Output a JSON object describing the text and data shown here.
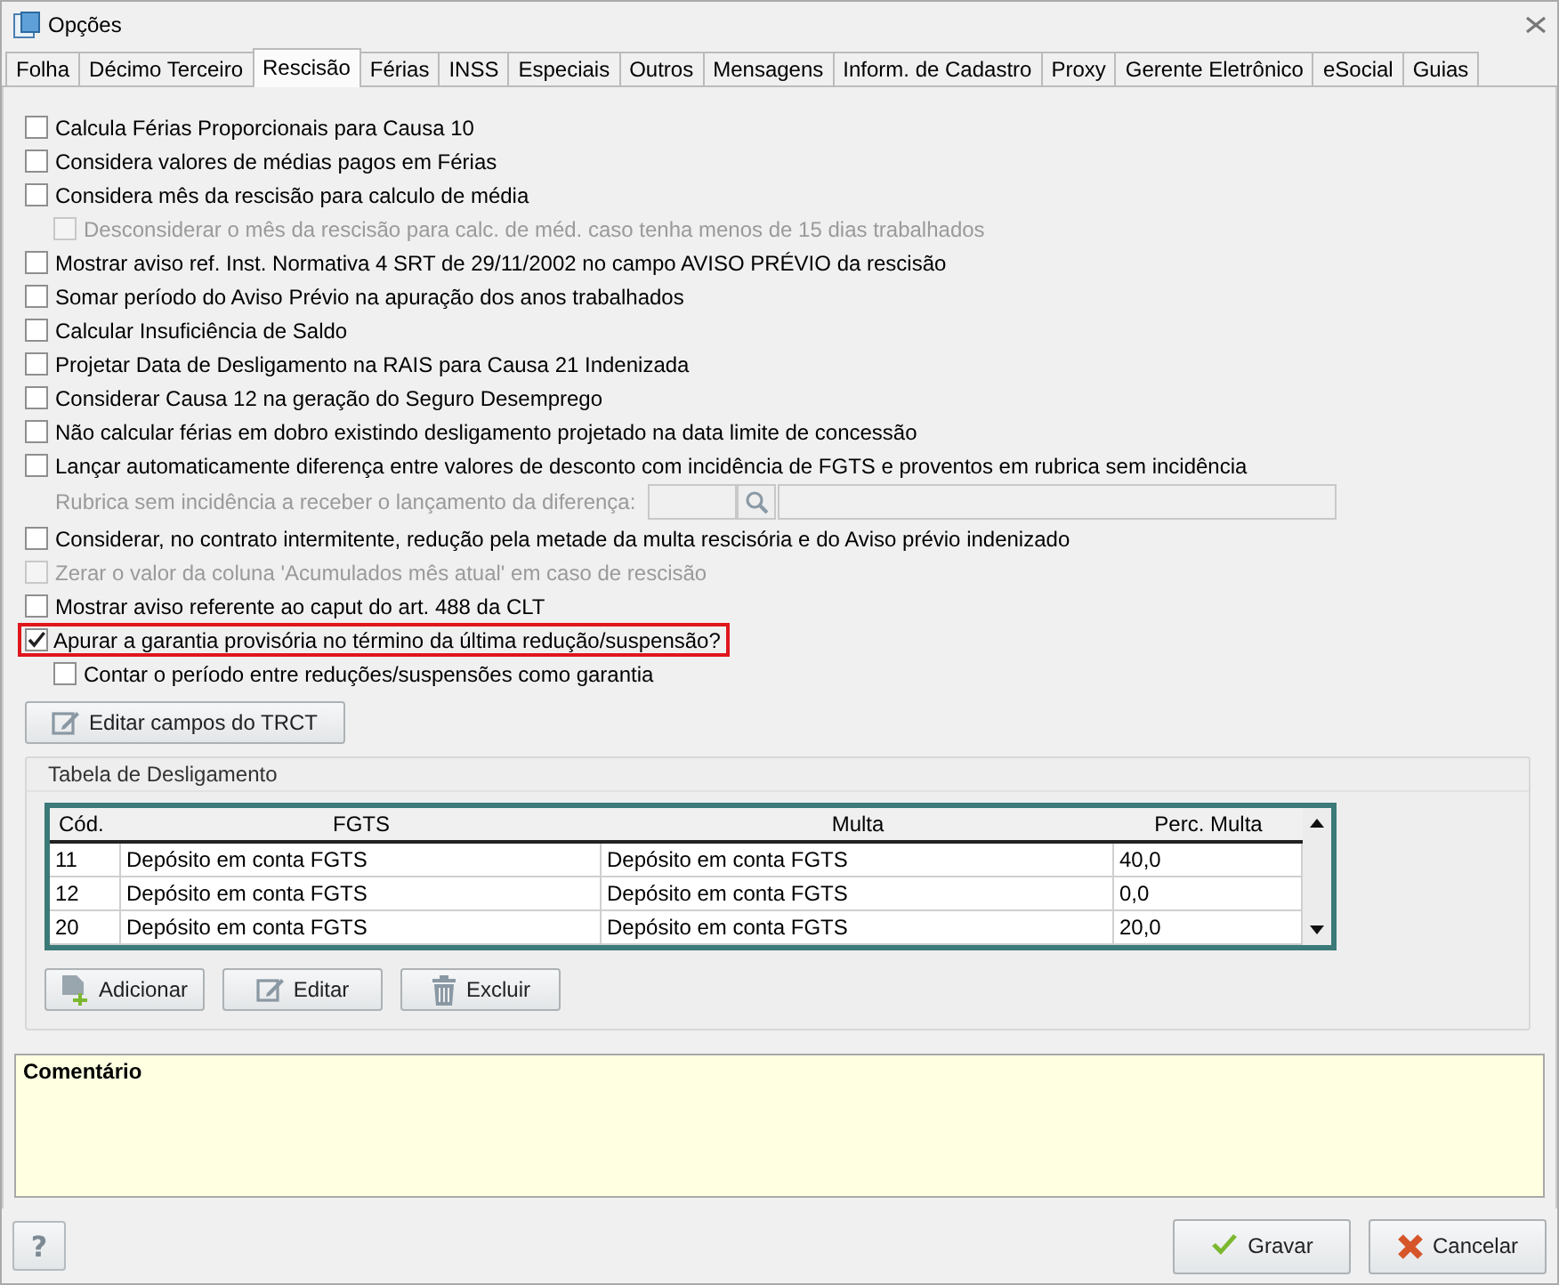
{
  "window": {
    "title": "Opções"
  },
  "tabs": [
    {
      "label": "Folha",
      "selected": false
    },
    {
      "label": "Décimo Terceiro",
      "selected": false
    },
    {
      "label": "Rescisão",
      "selected": true
    },
    {
      "label": "Férias",
      "selected": false
    },
    {
      "label": "INSS",
      "selected": false
    },
    {
      "label": "Especiais",
      "selected": false
    },
    {
      "label": "Outros",
      "selected": false
    },
    {
      "label": "Mensagens",
      "selected": false
    },
    {
      "label": "Inform. de Cadastro",
      "selected": false
    },
    {
      "label": "Proxy",
      "selected": false
    },
    {
      "label": "Gerente Eletrônico",
      "selected": false
    },
    {
      "label": "eSocial",
      "selected": false
    },
    {
      "label": "Guias",
      "selected": false
    }
  ],
  "options": [
    {
      "kind": "checkbox",
      "label": "Calcula Férias Proporcionais para Causa 10",
      "checked": false,
      "disabled": false,
      "highlighted": false
    },
    {
      "kind": "checkbox",
      "label": "Considera valores de médias pagos em Férias",
      "checked": false,
      "disabled": false,
      "highlighted": false
    },
    {
      "kind": "checkbox",
      "label": "Considera mês da rescisão para calculo de média",
      "checked": false,
      "disabled": false,
      "highlighted": false,
      "children": [
        {
          "kind": "checkbox",
          "label": "Desconsiderar o mês da rescisão para calc. de méd. caso tenha menos de 15 dias trabalhados",
          "checked": false,
          "disabled": true,
          "highlighted": false
        }
      ]
    },
    {
      "kind": "checkbox",
      "label": "Mostrar aviso ref. Inst. Normativa 4 SRT de 29/11/2002 no campo AVISO PRÉVIO da rescisão",
      "checked": false,
      "disabled": false,
      "highlighted": false
    },
    {
      "kind": "checkbox",
      "label": "Somar período do Aviso Prévio na apuração dos anos trabalhados",
      "checked": false,
      "disabled": false,
      "highlighted": false
    },
    {
      "kind": "checkbox",
      "label": "Calcular Insuficiência de Saldo",
      "checked": false,
      "disabled": false,
      "highlighted": false
    },
    {
      "kind": "checkbox",
      "label": "Projetar Data de Desligamento na RAIS para Causa 21 Indenizada",
      "checked": false,
      "disabled": false,
      "highlighted": false
    },
    {
      "kind": "checkbox",
      "label": "Considerar Causa 12 na geração do Seguro Desemprego",
      "checked": false,
      "disabled": false,
      "highlighted": false
    },
    {
      "kind": "checkbox",
      "label": "Não calcular férias em dobro existindo desligamento projetado na data limite de concessão",
      "checked": false,
      "disabled": false,
      "highlighted": false
    },
    {
      "kind": "checkbox",
      "label": "Lançar automaticamente diferença entre valores de desconto com incidência de FGTS e proventos em rubrica sem incidência",
      "checked": false,
      "disabled": false,
      "highlighted": false,
      "children": [
        {
          "kind": "lookup",
          "label": "Rubrica sem incidência a receber o lançamento da diferença:",
          "disabled": true
        }
      ]
    },
    {
      "kind": "checkbox",
      "label": "Considerar, no contrato intermitente, redução pela metade da multa rescisória e do Aviso prévio indenizado",
      "checked": false,
      "disabled": false,
      "highlighted": false
    },
    {
      "kind": "checkbox",
      "label": "Zerar o valor da coluna 'Acumulados mês atual' em caso de rescisão",
      "checked": false,
      "disabled": true,
      "highlighted": false
    },
    {
      "kind": "checkbox",
      "label": "Mostrar aviso referente ao caput do art. 488 da CLT",
      "checked": false,
      "disabled": false,
      "highlighted": false
    },
    {
      "kind": "checkbox",
      "label": "Apurar a garantia provisória no término da última redução/suspensão?",
      "checked": true,
      "disabled": false,
      "highlighted": true,
      "children": [
        {
          "kind": "checkbox",
          "label": "Contar o período entre reduções/suspensões como garantia",
          "checked": false,
          "disabled": false,
          "highlighted": false
        }
      ]
    }
  ],
  "edit_trct_button": "Editar campos do TRCT",
  "termination_table": {
    "title": "Tabela de Desligamento",
    "columns": [
      "Cód.",
      "FGTS",
      "Multa",
      "Perc. Multa"
    ],
    "rows": [
      [
        "11",
        "Depósito em conta FGTS",
        "Depósito em conta FGTS",
        "40,0"
      ],
      [
        "12",
        "Depósito em conta FGTS",
        "Depósito em conta FGTS",
        "0,0"
      ],
      [
        "20",
        "Depósito em conta FGTS",
        "Depósito em conta FGTS",
        "20,0"
      ]
    ],
    "buttons": [
      {
        "kind": "add",
        "label": "Adicionar"
      },
      {
        "kind": "edit",
        "label": "Editar"
      },
      {
        "kind": "delete",
        "label": "Excluir"
      }
    ]
  },
  "comment": {
    "label": "Comentário"
  },
  "help_button": "?",
  "footer_buttons": [
    {
      "kind": "save",
      "label": "Gravar"
    },
    {
      "kind": "cancel",
      "label": "Cancelar"
    }
  ]
}
